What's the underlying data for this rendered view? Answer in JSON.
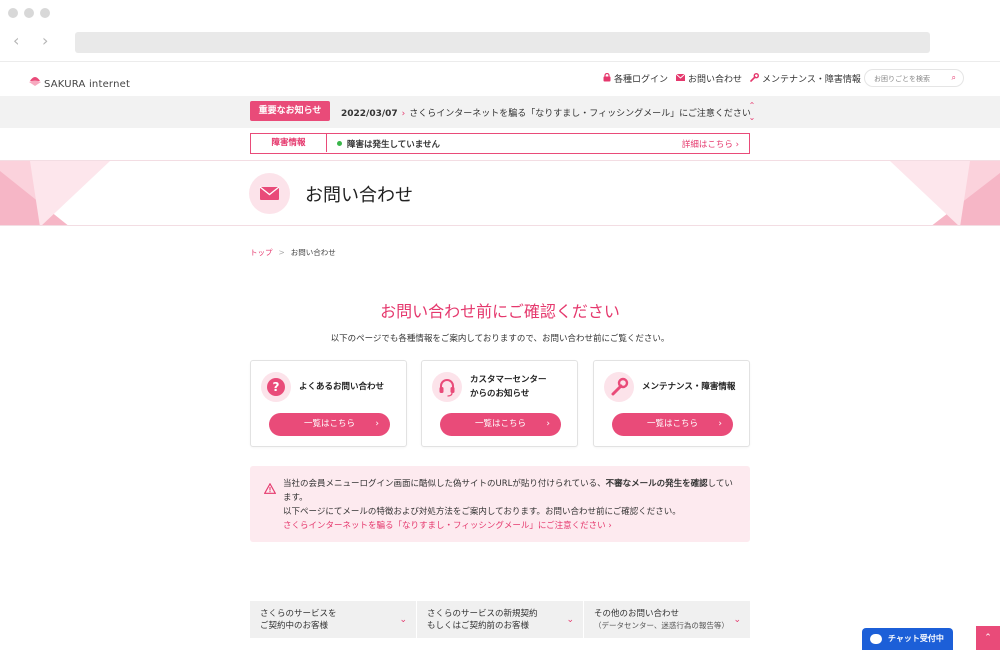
{
  "browser": {
    "back_icon": "‹",
    "forward_icon": "›"
  },
  "header": {
    "logo_text": "SAKURA internet",
    "nav": [
      {
        "icon": "lock-icon",
        "label": "各種ログイン"
      },
      {
        "icon": "mail-icon",
        "label": "お問い合わせ"
      },
      {
        "icon": "wrench-icon",
        "label": "メンテナンス・障害情報"
      }
    ],
    "search_placeholder": "お困りごとを検索",
    "search_icon": "⌕"
  },
  "notice": {
    "badge": "重要なお知らせ",
    "date": "2022/03/07",
    "arrow": "›",
    "text": "さくらインターネットを騙る「なりすまし・フィッシングメール」にご注意ください",
    "up": "⌃",
    "down": "⌄"
  },
  "trouble": {
    "label": "障害情報",
    "status": "障害は発生していません",
    "link": "詳細はこちら ›"
  },
  "hero": {
    "title": "お問い合わせ"
  },
  "breadcrumb": {
    "home": "トップ",
    "sep": ">",
    "current": "お問い合わせ"
  },
  "section": {
    "title": "お問い合わせ前にご確認ください",
    "lead": "以下のページでも各種情報をご案内しておりますので、お問い合わせ前にご覧ください。"
  },
  "cards": [
    {
      "icon": "question-icon",
      "title": "よくあるお問い合わせ",
      "button": "一覧はこちら"
    },
    {
      "icon": "headset-icon",
      "title": "カスタマーセンター\nからのお知らせ",
      "button": "一覧はこちら"
    },
    {
      "icon": "wrench-icon",
      "title": "メンテナンス・障害情報",
      "button": "一覧はこちら"
    }
  ],
  "card_chevron": "›",
  "alert": {
    "line1_a": "当社の会員メニューログイン画面に酷似した偽サイトのURLが貼り付けられている、",
    "line1_b": "不審なメールの発生を確認",
    "line1_c": "しています。",
    "line2": "以下ページにてメールの特徴および対処方法をご案内しております。お問い合わせ前にご確認ください。",
    "link": "さくらインターネットを騙る「なりすまし・フィッシングメール」にご注意ください ›"
  },
  "accordions": [
    {
      "line1": "さくらのサービスを",
      "line2": "ご契約中のお客様",
      "sub": ""
    },
    {
      "line1": "さくらのサービスの新規契約",
      "line2": "もしくはご契約前のお客様",
      "sub": ""
    },
    {
      "line1": "その他のお問い合わせ",
      "line2": "",
      "sub": "（データセンター、迷惑行為の報告等）"
    }
  ],
  "accordion_chevron": "⌄",
  "chat": {
    "label": "チャット受付中"
  },
  "top_button": "⌃",
  "colors": {
    "accent": "#e94b79",
    "accent_text": "#e5386d",
    "chat": "#1c5fd8"
  }
}
